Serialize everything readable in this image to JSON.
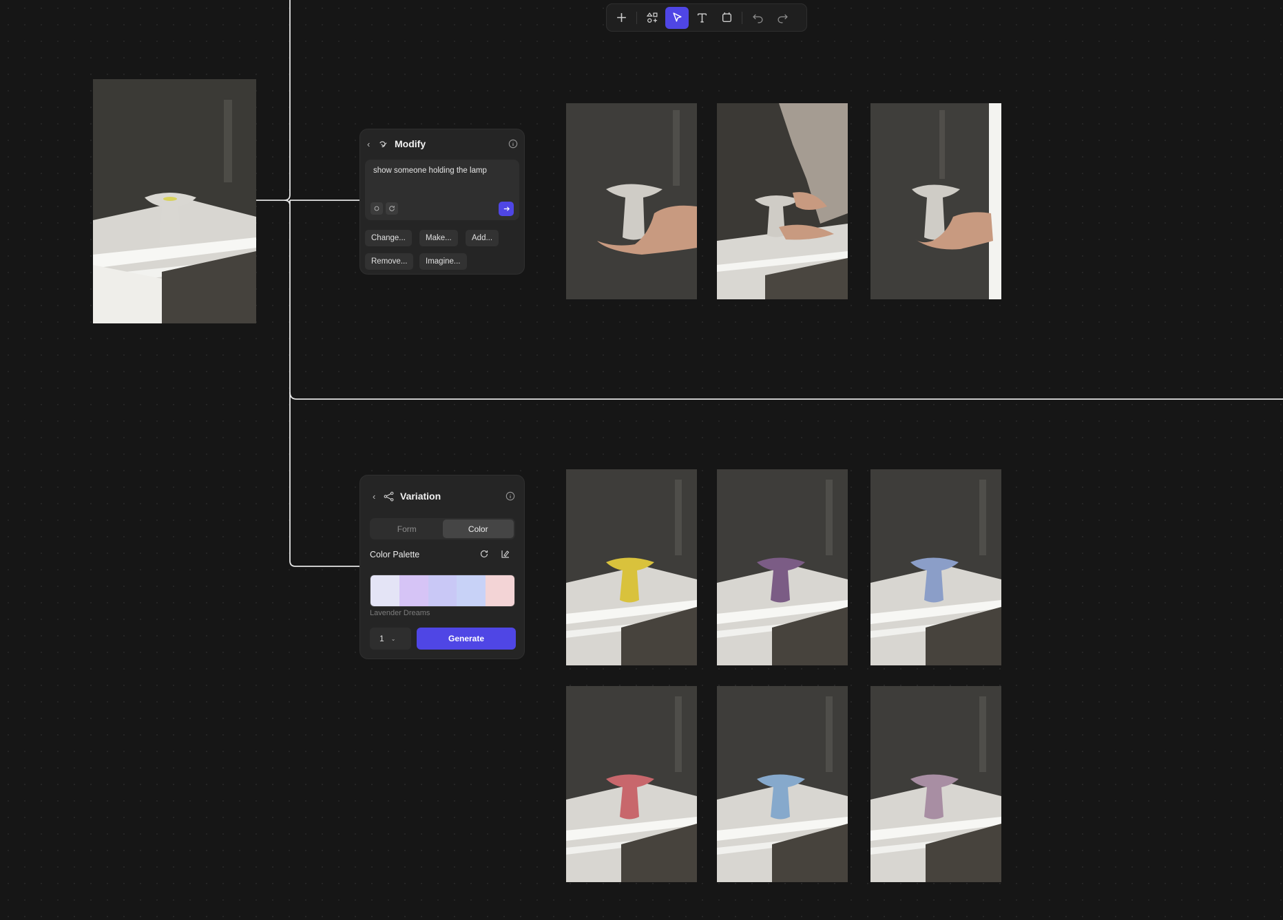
{
  "toolbar": {
    "tools": [
      {
        "icon": "plus-icon",
        "active": false
      },
      {
        "icon": "shapes-icon",
        "active": false
      },
      {
        "icon": "cursor-icon",
        "active": true
      },
      {
        "icon": "text-icon",
        "active": false
      },
      {
        "icon": "frame-icon",
        "active": false
      },
      {
        "icon": "undo-icon",
        "active": false
      },
      {
        "icon": "redo-icon",
        "active": false
      }
    ],
    "accent": "#4f46e5"
  },
  "modify_panel": {
    "title": "Modify",
    "prompt": "show someone holding the lamp",
    "chips": [
      "Change...",
      "Make...",
      "Add...",
      "Remove...",
      "Imagine..."
    ]
  },
  "variation_panel": {
    "title": "Variation",
    "tabs": [
      "Form",
      "Color"
    ],
    "active_tab": "Color",
    "section_label": "Color Palette",
    "palette_colors": [
      "#e4e4f6",
      "#d6c4f6",
      "#c9c8f6",
      "#c8d2f7",
      "#f3d4d6"
    ],
    "palette_name": "Lavender Dreams",
    "count": "1",
    "generate_label": "Generate"
  },
  "images": {
    "source": {
      "lamp_color": "#d9d7d2",
      "scene": "lamp-on-table"
    },
    "modify_results": [
      {
        "scene": "hands-holding-lamp"
      },
      {
        "scene": "person-holding-lamp-on-table"
      },
      {
        "scene": "hands-holding-lamp-bright"
      }
    ],
    "variation_results": [
      {
        "lamp_color": "#d9c23c"
      },
      {
        "lamp_color": "#7b5c85"
      },
      {
        "lamp_color": "#8b9ec8"
      },
      {
        "lamp_color": "#c8676c"
      },
      {
        "lamp_color": "#86a9cc"
      },
      {
        "lamp_color": "#a88ea3"
      }
    ]
  }
}
